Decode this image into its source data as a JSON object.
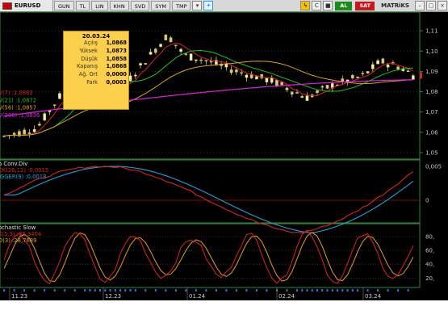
{
  "toolbar": {
    "symbol": "EURUSD",
    "buttons": [
      "GUN",
      "TL",
      "LIN",
      "KHN",
      "SVD",
      "SYM",
      "TMP"
    ],
    "al_label": "AL",
    "sat_label": "SAT",
    "brand": "MATRiKS"
  },
  "tooltip": {
    "date": "20.03.24",
    "rows": [
      {
        "k": "Açılış",
        "v": "1,0868"
      },
      {
        "k": "Yüksek",
        "v": "1,0873"
      },
      {
        "k": "Düşük",
        "v": "1,0858"
      },
      {
        "k": "Kapanış",
        "v": "1,0868"
      },
      {
        "k": "Ağ. Ort",
        "v": "0,0000"
      },
      {
        "k": "Fark",
        "v": "0,0003"
      }
    ]
  },
  "price_panel": {
    "legend": [
      {
        "label": "AV(7)",
        "value": ":1,0863",
        "color": "#e02020"
      },
      {
        "label": "AV(21)",
        "value": ":1,0872",
        "color": "#20c020"
      },
      {
        "label": "AV(56)",
        "value": ":1,0857",
        "color": "#e0a020"
      },
      {
        "label": "AV(200)",
        "value": ":1,0836",
        "color": "#e020e0"
      }
    ],
    "y_ticks": [
      "1,11",
      "1,10",
      "1,09",
      "1,08",
      "1,07",
      "1,06",
      "1,05"
    ],
    "last_price": "1,09"
  },
  "macd_panel": {
    "title": "o Conv.Div",
    "legend": [
      {
        "label": "CK(26,12)",
        "value": ":0,0015",
        "color": "#e02020"
      },
      {
        "label": "IGGER(9)",
        "value": ":0,0018",
        "color": "#20a0e0"
      }
    ],
    "y_ticks": [
      "0,005",
      "0"
    ]
  },
  "stoch_panel": {
    "title": "ochastic Slow",
    "legend": [
      {
        "label": "K(5,3)",
        "value": ":35,3404",
        "color": "#e02020"
      },
      {
        "label": "D(3)",
        "value": ":28,7689",
        "color": "#e0a020"
      }
    ],
    "y_ticks": [
      "80,",
      "60,",
      "40,",
      "20,"
    ]
  },
  "x_axis": [
    "11.23",
    "12.23",
    "01.24",
    "02.24",
    "03.24"
  ]
}
